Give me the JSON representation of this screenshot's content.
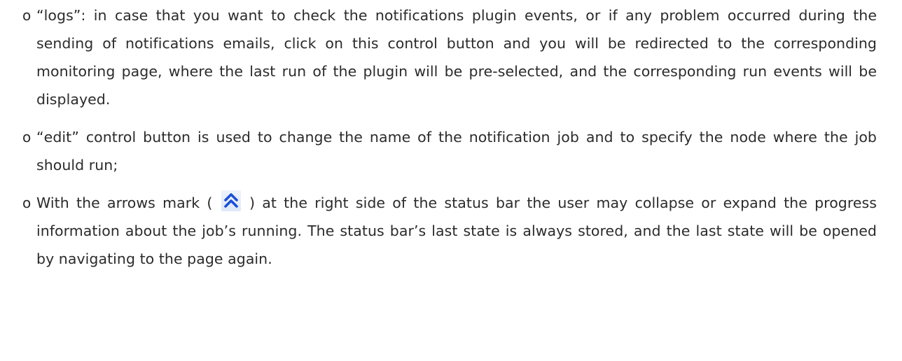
{
  "bullets": [
    {
      "marker": "o",
      "text": "“logs”: in case that you want to check the notifications plugin events, or if any problem occurred during the sending of notifications emails, click on this control button and you will be redirected to the corresponding monitoring page, where the last run of the plugin will be pre-selected, and the corresponding run events will be displayed."
    },
    {
      "marker": "o",
      "text": "“edit” control button is used to change the name of the notification job and to specify the node where the job should run;"
    },
    {
      "marker": "o",
      "text_before": "With the arrows mark (",
      "icon": "double-chevron-up-icon",
      "text_after": ") at the right side of the status bar the user may collapse or expand the progress information about the job’s running. The status bar’s last state is always stored, and the last state will be opened by navigating to the page again."
    }
  ],
  "colors": {
    "text": "#2b2b2b",
    "icon_blue": "#1a4fd8",
    "icon_bg": "#e6edf8"
  }
}
